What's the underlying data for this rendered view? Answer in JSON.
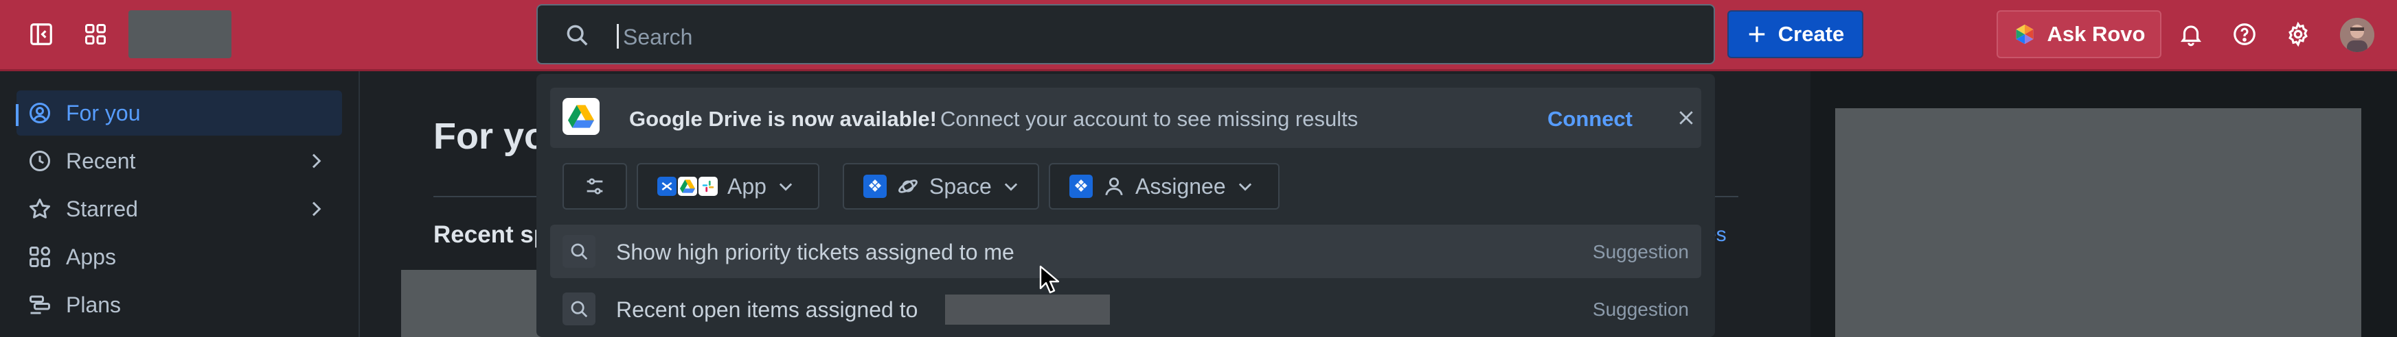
{
  "topbar": {
    "search_placeholder": "Search",
    "create_label": "Create",
    "rovo_label": "Ask Rovo"
  },
  "sidebar": {
    "items": [
      {
        "label": "For you",
        "icon": "user-circle-icon"
      },
      {
        "label": "Recent",
        "icon": "clock-icon"
      },
      {
        "label": "Starred",
        "icon": "star-icon"
      },
      {
        "label": "Apps",
        "icon": "apps-icon"
      },
      {
        "label": "Plans",
        "icon": "plans-icon"
      }
    ]
  },
  "main": {
    "title": "For yo",
    "subtitle": "Recent sp",
    "link_fragment": "es"
  },
  "dropdown": {
    "banner": {
      "title": "Google Drive is now available!",
      "text": "Connect your account to see missing results",
      "action": "Connect"
    },
    "filters": [
      {
        "label": "App"
      },
      {
        "label": "Space"
      },
      {
        "label": "Assignee"
      }
    ],
    "suggestions": [
      {
        "text": "Show high priority tickets assigned to me",
        "tag": "Suggestion"
      },
      {
        "text": "Recent open items assigned to",
        "tag": "Suggestion"
      }
    ]
  },
  "colors": {
    "topbar": "#b12e45",
    "accent": "#579dff",
    "create_button": "#0b52c5",
    "background": "#1d2125",
    "dropdown": "#282e33"
  }
}
